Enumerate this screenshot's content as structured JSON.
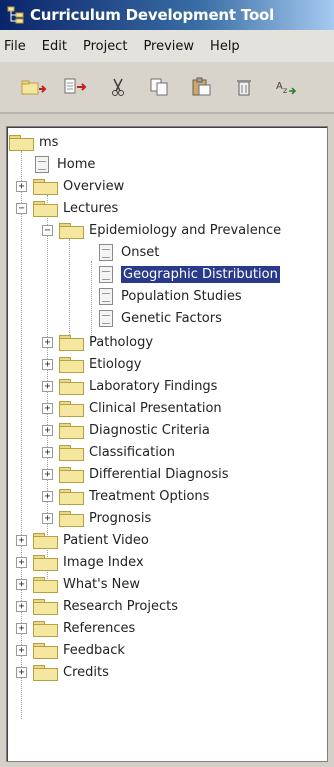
{
  "window": {
    "title": "Curriculum Development Tool",
    "icon": "app-tree-icon"
  },
  "menu": {
    "file": "File",
    "edit": "Edit",
    "project": "Project",
    "preview": "Preview",
    "help": "Help"
  },
  "toolbar": {
    "buttons": [
      "new-folder-icon",
      "new-page-icon",
      "cut-icon",
      "copy-icon",
      "paste-icon",
      "delete-icon",
      "rename-icon"
    ]
  },
  "tree": {
    "root": "ms",
    "home": "Home",
    "overview": "Overview",
    "lectures": "Lectures",
    "epidemiology": "Epidemiology and Prevalence",
    "onset": "Onset",
    "geographic": "Geographic Distribution",
    "population": "Population Studies",
    "genetic": "Genetic Factors",
    "pathology": "Pathology",
    "etiology": "Etiology",
    "laboratory": "Laboratory Findings",
    "clinical": "Clinical Presentation",
    "diagnostic": "Diagnostic Criteria",
    "classification": "Classification",
    "differential": "Differential Diagnosis",
    "treatment": "Treatment Options",
    "prognosis": "Prognosis",
    "patient_video": "Patient Video",
    "image_index": "Image Index",
    "whats_new": "What's New",
    "research": "Research Projects",
    "references": "References",
    "feedback": "Feedback",
    "credits": "Credits"
  },
  "colors": {
    "selection": "#2a3a8a",
    "title_bar": "#0a246a",
    "folder": "#f5e7a0"
  }
}
